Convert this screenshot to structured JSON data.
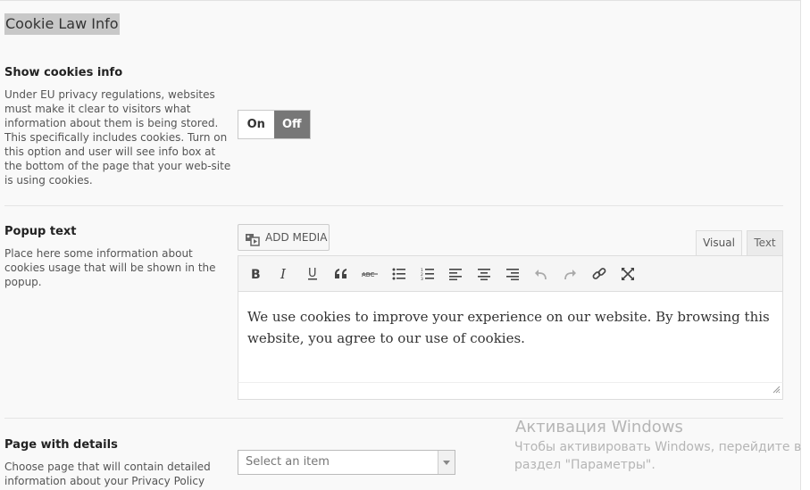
{
  "section": {
    "title": "Cookie Law Info"
  },
  "show_cookies": {
    "label": "Show cookies info",
    "description": "Under EU privacy regulations, websites must make it clear to visitors what information about them is being stored. This specifically includes cookies. Turn on this option and user will see info box at the bottom of the page that your web-site is using cookies.",
    "toggle": {
      "on_label": "On",
      "off_label": "Off",
      "selected": "Off"
    }
  },
  "popup_text": {
    "label": "Popup text",
    "description": "Place here some information about cookies usage that will be shown in the popup.",
    "add_media_label": "ADD MEDIA",
    "tabs": [
      {
        "label": "Visual",
        "active": true
      },
      {
        "label": "Text",
        "active": false
      }
    ],
    "toolbar": [
      "bold-icon",
      "italic-icon",
      "underline-icon",
      "blockquote-icon",
      "strikethrough-icon",
      "bullet-list-icon",
      "numbered-list-icon",
      "align-left-icon",
      "align-center-icon",
      "align-right-icon",
      "undo-icon",
      "redo-icon",
      "link-icon",
      "fullscreen-icon"
    ],
    "content": "We use cookies to improve your experience on our website. By browsing this website, you agree to our use of cookies."
  },
  "page_details": {
    "label": "Page with details",
    "description": "Choose page that will contain detailed information about your Privacy Policy",
    "select_placeholder": "Select an item"
  },
  "watermark": {
    "title": "Активация Windows",
    "line1": "Чтобы активировать Windows, перейдите в",
    "line2": "раздел \"Параметры\"."
  }
}
